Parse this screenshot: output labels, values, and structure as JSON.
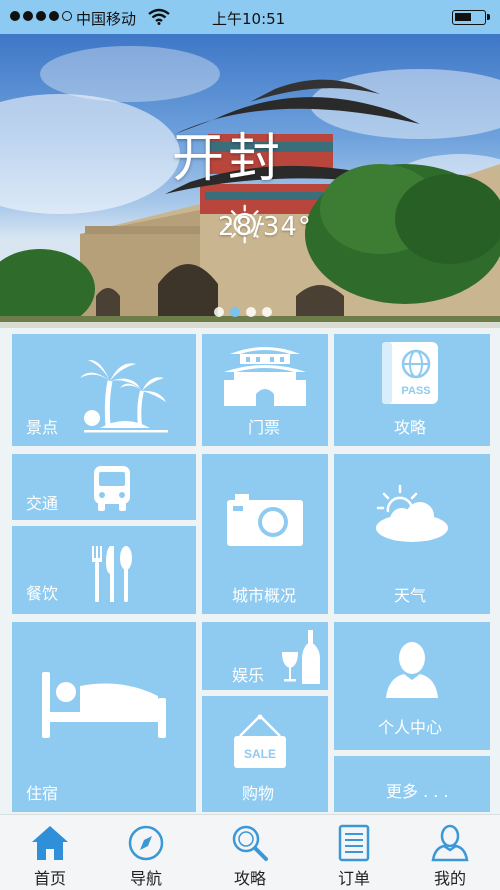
{
  "status_bar": {
    "carrier": "中国移动",
    "time": "上午10:51",
    "signal_bars_filled": 4,
    "signal_bars_total": 5
  },
  "hero": {
    "city": "开封",
    "temperature": "28/34°",
    "weather_icon": "sunny-icon",
    "carousel_pages": 4,
    "carousel_active_index": 1
  },
  "tiles": {
    "scenic": {
      "label": "景点",
      "icon": "palm-tree-icon"
    },
    "tickets": {
      "label": "门票",
      "icon": "city-gate-icon"
    },
    "guide": {
      "label": "攻略",
      "icon": "passport-icon"
    },
    "transport": {
      "label": "交通",
      "icon": "bus-icon"
    },
    "city_overview": {
      "label": "城市概况",
      "icon": "camera-icon"
    },
    "weather": {
      "label": "天气",
      "icon": "partly-cloudy-icon"
    },
    "dining": {
      "label": "餐饮",
      "icon": "cutlery-icon"
    },
    "lodging": {
      "label": "住宿",
      "icon": "bed-icon"
    },
    "entertainment": {
      "label": "娱乐",
      "icon": "wine-icon"
    },
    "profile": {
      "label": "个人中心",
      "icon": "person-icon"
    },
    "shopping": {
      "label": "购物",
      "icon": "sale-sign-icon",
      "sign_text": "SALE"
    },
    "more": {
      "label": "更多 . . ."
    }
  },
  "passport_text": "PASS",
  "tab_bar": {
    "active_index": 0,
    "items": [
      {
        "label": "首页",
        "icon": "home-icon"
      },
      {
        "label": "导航",
        "icon": "compass-icon"
      },
      {
        "label": "攻略",
        "icon": "search-icon"
      },
      {
        "label": "订单",
        "icon": "order-list-icon"
      },
      {
        "label": "我的",
        "icon": "user-icon"
      }
    ]
  },
  "colors": {
    "accent": "#8fcbf1",
    "status_bar": "#8dcaf1",
    "tab_active": "#2f8fd8",
    "tab_inactive": "#3a98d8"
  }
}
